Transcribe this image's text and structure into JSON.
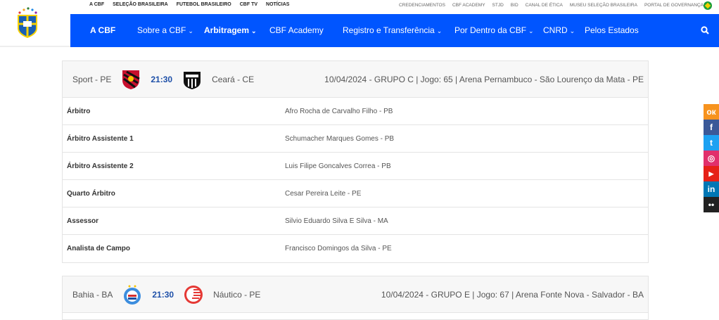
{
  "top_links_left": [
    "A CBF",
    "SELEÇÃO BRASILEIRA",
    "FUTEBOL BRASILEIRO",
    "CBF TV",
    "NOTÍCIAS"
  ],
  "top_links_right": [
    "CREDENCIAMENTOS",
    "CBF ACADEMY",
    "STJD",
    "BID",
    "CANAL DE ÉTICA",
    "MUSEU SELEÇÃO BRASILEIRA",
    "PORTAL DE GOVERNANÇA"
  ],
  "nav": [
    {
      "label": "A CBF"
    },
    {
      "label": "Sobre a CBF"
    },
    {
      "label": "Arbitragem"
    },
    {
      "label": "CBF Academy"
    },
    {
      "label": "Registro e Transferência"
    },
    {
      "label": "Por Dentro da CBF"
    },
    {
      "label": "CNRD"
    },
    {
      "label": "Pelos Estados"
    }
  ],
  "chevron": "⌄",
  "logo_text": "CBF",
  "matches": [
    {
      "home": "Sport - PE",
      "time": "21:30",
      "away": "Ceará - CE",
      "info": "10/04/2024 - GRUPO C | Jogo: 65 | Arena Pernambuco - São Lourenço da Mata - PE",
      "officials": [
        {
          "role": "Árbitro",
          "name": "Afro Rocha de Carvalho Filho - PB"
        },
        {
          "role": "Árbitro Assistente 1",
          "name": "Schumacher Marques Gomes - PB"
        },
        {
          "role": "Árbitro Assistente 2",
          "name": "Luis Filipe Goncalves Correa - PB"
        },
        {
          "role": "Quarto Árbitro",
          "name": "Cesar Pereira Leite - PE"
        },
        {
          "role": "Assessor",
          "name": "Silvio Eduardo Silva E Silva - MA"
        },
        {
          "role": "Analista de Campo",
          "name": "Francisco Domingos da Silva - PE"
        }
      ]
    },
    {
      "home": "Bahia - BA",
      "time": "21:30",
      "away": "Náutico - PE",
      "info": "10/04/2024 - GRUPO E | Jogo: 67 | Arena Fonte Nova - Salvador - BA"
    }
  ],
  "social": [
    {
      "name": "ok",
      "color": "#f7931e",
      "glyph": "ок"
    },
    {
      "name": "facebook",
      "color": "#3b5998",
      "glyph": "f"
    },
    {
      "name": "twitter",
      "color": "#1da1f2",
      "glyph": "t"
    },
    {
      "name": "instagram",
      "color": "#e1306c",
      "glyph": "◎"
    },
    {
      "name": "youtube",
      "color": "#e62117",
      "glyph": "▶"
    },
    {
      "name": "linkedin",
      "color": "#0077b5",
      "glyph": "in"
    },
    {
      "name": "flickr",
      "color": "#222222",
      "glyph": "••"
    }
  ]
}
